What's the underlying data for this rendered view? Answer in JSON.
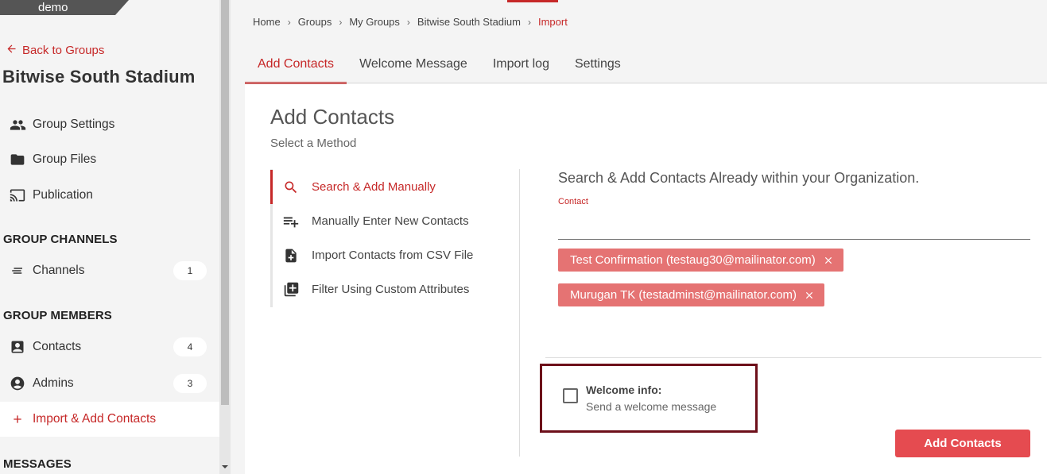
{
  "env": {
    "label": "demo"
  },
  "sidebar": {
    "back_label": "Back to Groups",
    "group_title": "Bitwise South Stadium",
    "items": [
      {
        "label": "Group Settings",
        "icon": "people-icon"
      },
      {
        "label": "Group Files",
        "icon": "folder-icon"
      },
      {
        "label": "Publication",
        "icon": "cast-icon"
      }
    ],
    "channels_heading": "GROUP CHANNELS",
    "channels": {
      "label": "Channels",
      "count": "1",
      "icon": "channels-icon"
    },
    "members_heading": "GROUP MEMBERS",
    "contacts": {
      "label": "Contacts",
      "count": "4",
      "icon": "contact-card-icon"
    },
    "admins": {
      "label": "Admins",
      "count": "3",
      "icon": "account-circle-icon"
    },
    "import": {
      "label": "Import & Add Contacts",
      "icon": "plus-icon"
    },
    "messages_heading": "MESSAGES"
  },
  "breadcrumb": [
    "Home",
    "Groups",
    "My Groups",
    "Bitwise South Stadium",
    "Import"
  ],
  "tabs": [
    "Add Contacts",
    "Welcome Message",
    "Import log",
    "Settings"
  ],
  "panel": {
    "title": "Add Contacts",
    "subtitle": "Select a Method",
    "methods": [
      {
        "label": "Search & Add Manually",
        "icon": "search-icon"
      },
      {
        "label": "Manually Enter New Contacts",
        "icon": "playlist-add-icon"
      },
      {
        "label": "Import Contacts from CSV File",
        "icon": "file-add-icon"
      },
      {
        "label": "Filter Using Custom Attributes",
        "icon": "library-add-icon"
      }
    ],
    "right_title": "Search & Add Contacts Already within your Organization.",
    "contact_label": "Contact",
    "contact_value": "",
    "chips": [
      "Test Confirmation (testaug30@mailinator.com)",
      "Murugan TK (testadminst@mailinator.com)"
    ],
    "welcome_title": "Welcome info:",
    "welcome_sub": "Send a welcome message",
    "welcome_checked": false,
    "submit_label": "Add Contacts"
  },
  "colors": {
    "accent": "#c62828",
    "button": "#e54b50",
    "chip": "#e57373",
    "highlight_box": "#6d0f1a"
  }
}
